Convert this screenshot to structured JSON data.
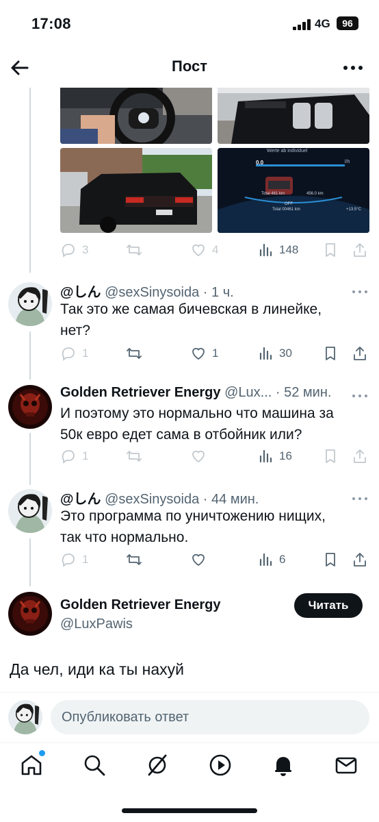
{
  "status_bar": {
    "time": "17:08",
    "network": "4G",
    "battery": "96"
  },
  "nav": {
    "title": "Пост"
  },
  "parent_tweet": {
    "stats": {
      "replies": "3",
      "retweets": "",
      "likes": "4",
      "views": "148"
    },
    "media": [
      {
        "icon": "steering-wheel-photo"
      },
      {
        "icon": "car-front-grille-photo"
      },
      {
        "icon": "car-rear-photo"
      },
      {
        "icon": "dashboard-display-photo",
        "display_text": "Werte ab individuel",
        "speed": "0.0",
        "speed_unit": "l/h",
        "total_km": "Total 461 km",
        "range_km": "456.0 km",
        "off": "OFF",
        "odometer": "Total 00461 km",
        "temp": "+13.5°C"
      }
    ]
  },
  "replies": [
    {
      "name": "@しん",
      "handle": "@sexSinysoida",
      "time": "· 1 ч.",
      "text_lines": [
        "Так это же самая бичевская в линейке,",
        "нет?"
      ],
      "stats": {
        "replies": "1",
        "retweets": "",
        "likes": "1",
        "views": "30"
      },
      "avatar": "anime-avatar"
    },
    {
      "name": "Golden Retriever Energy",
      "handle": "@Lux...",
      "time": "· 52 мин.",
      "text_lines": [
        "И поэтому это нормально что машина за",
        "50к евро едет сама в отбойник или?"
      ],
      "stats": {
        "replies": "1",
        "retweets": "",
        "likes": "",
        "views": "16"
      },
      "avatar": "red-skull-avatar"
    },
    {
      "name": "@しん",
      "handle": "@sexSinysoida",
      "time": "· 44 мин.",
      "text_lines": [
        "Это программа по уничтожению нищих,",
        "так что нормально."
      ],
      "stats": {
        "replies": "1",
        "retweets": "",
        "likes": "",
        "views": "6"
      },
      "avatar": "anime-avatar"
    }
  ],
  "main_tweet": {
    "name": "Golden Retriever Energy",
    "handle": "@LuxPawis",
    "follow_label": "Читать",
    "text": "Да чел, иди ка ты нахуй"
  },
  "reply_box": {
    "placeholder": "Опубликовать ответ"
  },
  "bottom_nav": [
    "home-icon",
    "search-icon",
    "grok-icon",
    "play-icon",
    "bell-icon",
    "mail-icon"
  ],
  "colors": {
    "secondary_text": "#536471",
    "primary_text": "#0f1419",
    "accent": "#1d9bf0",
    "divider": "#eff3f4"
  }
}
